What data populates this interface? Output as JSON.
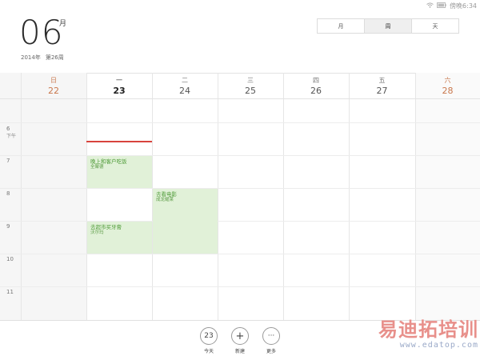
{
  "status_bar": {
    "time": "傍晚6:34"
  },
  "header": {
    "month_number": "06",
    "month_char": "月",
    "year": "2014年",
    "week": "第26周"
  },
  "view_switch": {
    "month": "月",
    "week": "周",
    "day": "天",
    "active": "周"
  },
  "days": [
    {
      "weekday": "日",
      "date": "22"
    },
    {
      "weekday": "一",
      "date": "23"
    },
    {
      "weekday": "二",
      "date": "24"
    },
    {
      "weekday": "三",
      "date": "25"
    },
    {
      "weekday": "四",
      "date": "26"
    },
    {
      "weekday": "五",
      "date": "27"
    },
    {
      "weekday": "六",
      "date": "28"
    }
  ],
  "hours": [
    {
      "label": "6",
      "sub": "下午"
    },
    {
      "label": "7",
      "sub": ""
    },
    {
      "label": "8",
      "sub": ""
    },
    {
      "label": "9",
      "sub": ""
    },
    {
      "label": "10",
      "sub": ""
    },
    {
      "label": "11",
      "sub": ""
    }
  ],
  "events": [
    {
      "title": "晚上和客户吃饭",
      "location": "全聚德"
    },
    {
      "title": "去看电影",
      "location": "成龙耀莱"
    },
    {
      "title": "去超市买牙膏",
      "location": "沃尔玛"
    }
  ],
  "toolbar": {
    "today_number": "23",
    "today_label": "今天",
    "new_icon": "+",
    "new_label": "新建",
    "more_icon": "···",
    "more_label": "更多"
  },
  "watermark": {
    "text": "易迪拓培训",
    "url": "www.edatop.com"
  },
  "colors": {
    "event_bg": "#e1f1d8",
    "event_text": "#4d9a36",
    "now_line": "#d8443d",
    "weekend": "#c9784d"
  }
}
